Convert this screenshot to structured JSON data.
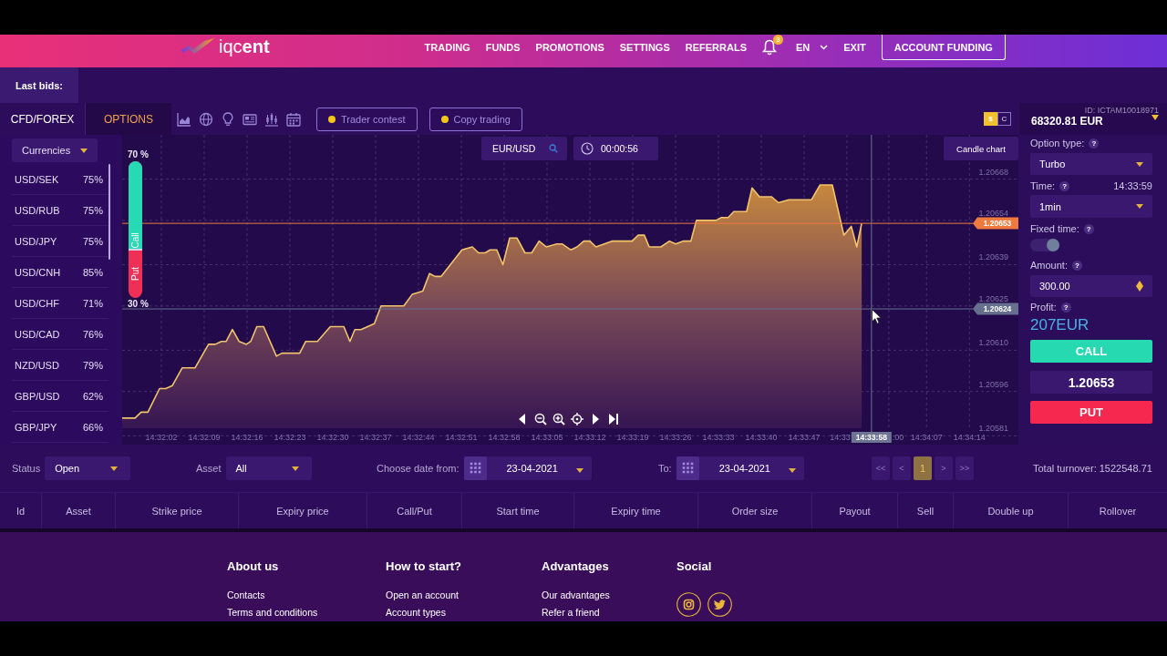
{
  "header": {
    "logo": "iqc**ent**",
    "nav": [
      "TRADING",
      "FUNDS",
      "PROMOTIONS",
      "SETTINGS",
      "REFERRALS"
    ],
    "notification_count": "3",
    "language": "EN",
    "exit": "EXIT",
    "funding_button": "ACCOUNT FUNDING"
  },
  "last_bids": "Last bids:",
  "toolbar": {
    "tabs": [
      {
        "label": "CFD/FOREX",
        "selected": false
      },
      {
        "label": "OPTIONS",
        "selected": true
      }
    ],
    "buttons": [
      "Trader contest",
      "Copy trading"
    ]
  },
  "account": {
    "currency_toggle": [
      {
        "label": "$",
        "selected": true
      },
      {
        "label": "C",
        "selected": false
      }
    ],
    "id": "ID: ICTAM10018971",
    "balance": "68320.81 EUR"
  },
  "sidebar": {
    "filter": "Currencies",
    "assets": [
      {
        "pair": "USD/SEK",
        "payout": "75%"
      },
      {
        "pair": "USD/RUB",
        "payout": "75%"
      },
      {
        "pair": "USD/JPY",
        "payout": "75%"
      },
      {
        "pair": "USD/CNH",
        "payout": "85%"
      },
      {
        "pair": "USD/CHF",
        "payout": "71%"
      },
      {
        "pair": "USD/CAD",
        "payout": "76%"
      },
      {
        "pair": "NZD/USD",
        "payout": "79%"
      },
      {
        "pair": "GBP/USD",
        "payout": "62%"
      },
      {
        "pair": "GBP/JPY",
        "payout": "66%"
      }
    ]
  },
  "chart": {
    "symbol": "EUR/USD",
    "timer": "00:00:56",
    "type_button": "Candle chart",
    "sentiment": {
      "call_percent": "70 %",
      "call_label": "Call",
      "put_label": "Put",
      "put_percent": "30 %",
      "level": 0.65
    },
    "cursor_time": "14:33:58",
    "cut_tick_labels": [
      "14:33",
      ":00"
    ],
    "chart_data": {
      "type": "area",
      "grid": true,
      "x": [
        52315.6,
        52317.7,
        52318.7,
        52319.8,
        52321.7,
        52322.7,
        52323.8,
        52325.4,
        52327.5,
        52329.7,
        52330.8,
        52331.8,
        52332.6,
        52333.6,
        52334.7,
        52335.9,
        52336.6,
        52337.6,
        52338.7,
        52340.8,
        52341.7,
        52344.6,
        52345.6,
        52347.5,
        52349.6,
        52351.8,
        52352.8,
        52353.6,
        52354.6,
        52356.8,
        52357.9,
        52361.6,
        52363,
        52364.7,
        52365.8,
        52366.7,
        52367.7,
        52371.1,
        52372.8,
        52373.8,
        52374.9,
        52375.7,
        52376.8,
        52377.8,
        52378.9,
        52380.1,
        52381.4,
        52382.5,
        52383.7,
        52384.9,
        52386.6,
        52387.5,
        52388.9,
        52389.9,
        52391,
        52392,
        52393,
        52395.7,
        52398.9,
        52399.9,
        52400.9,
        52401.7,
        52403.6,
        52405,
        52406,
        52407.3,
        52408.5,
        52409.4,
        52412.6,
        52413.5,
        52414.6,
        52415.5,
        52417.6,
        52418.5,
        52419.7,
        52421.7,
        52422.8,
        52424.5,
        52428.2,
        52429.6,
        52431.6,
        52433.5,
        52434.7,
        52435.6,
        52436.4
      ],
      "series": [
        {
          "color": "#f2c46a",
          "values": [
            1.20587,
            1.20587,
            1.20589,
            1.20589,
            1.20597,
            1.20597,
            1.20598,
            1.20604,
            1.20604,
            1.20612,
            1.20612,
            1.20613,
            1.20613,
            1.20617,
            1.20613,
            1.20612,
            1.20613,
            1.20618,
            1.20618,
            1.20608,
            1.20609,
            1.20609,
            1.20613,
            1.20613,
            1.20618,
            1.20618,
            1.20613,
            1.20617,
            1.20617,
            1.20619,
            1.20625,
            1.20625,
            1.20629,
            1.2063,
            1.20636,
            1.20635,
            1.20635,
            1.20644,
            1.20645,
            1.20643,
            1.20643,
            1.20644,
            1.20644,
            1.20639,
            1.20648,
            1.20648,
            1.20643,
            1.20643,
            1.20647,
            1.20645,
            1.20646,
            1.20646,
            1.20644,
            1.20645,
            1.20647,
            1.20647,
            1.20645,
            1.20647,
            1.20647,
            1.20649,
            1.20649,
            1.20645,
            1.20645,
            1.20647,
            1.20646,
            1.20647,
            1.20647,
            1.20654,
            1.20654,
            1.20655,
            1.20655,
            1.20657,
            1.20657,
            1.20665,
            1.20662,
            1.20662,
            1.2066,
            1.20661,
            1.20661,
            1.20666,
            1.20666,
            1.20649,
            1.20652,
            1.20645,
            1.20653
          ]
        }
      ],
      "xlim": [
        52315.6,
        52462
      ],
      "ylim": [
        1.20578,
        1.20683
      ],
      "xticks": [
        {
          "value": 52322,
          "label": "14:32:02"
        },
        {
          "value": 52329,
          "label": "14:32:09"
        },
        {
          "value": 52336,
          "label": "14:32:16"
        },
        {
          "value": 52343,
          "label": "14:32:23"
        },
        {
          "value": 52350,
          "label": "14:32:30"
        },
        {
          "value": 52357,
          "label": "14:32:37"
        },
        {
          "value": 52364,
          "label": "14:32:44"
        },
        {
          "value": 52371,
          "label": "14:32:51"
        },
        {
          "value": 52378,
          "label": "14:32:58"
        },
        {
          "value": 52385,
          "label": "14:33:05"
        },
        {
          "value": 52392,
          "label": "14:33:12"
        },
        {
          "value": 52399,
          "label": "14:33:19"
        },
        {
          "value": 52406,
          "label": "14:33:26"
        },
        {
          "value": 52413,
          "label": "14:33:33"
        },
        {
          "value": 52420,
          "label": "14:33:40"
        },
        {
          "value": 52427,
          "label": "14:33:47"
        },
        {
          "value": 52447,
          "label": "14:34:07"
        },
        {
          "value": 52454,
          "label": "14:34:14"
        }
      ],
      "yticks": [
        1.20668,
        1.20654,
        1.20639,
        1.20625,
        {
          "value": 1.2061,
          "label": "1.20610"
        },
        1.20596,
        1.20581
      ],
      "ref_lines": [
        {
          "axis": "y",
          "value": 1.20653,
          "label": "1.20653",
          "color": "#ef7a3f"
        },
        {
          "axis": "y",
          "value": 1.20624,
          "label": "1.20624",
          "color": "#66708e"
        },
        {
          "axis": "x",
          "value": 52438,
          "color": "#6e7494"
        }
      ]
    }
  },
  "trade": {
    "option_type": {
      "label": "Option type:",
      "help": "?",
      "value": "Turbo"
    },
    "time": {
      "label": "Time:",
      "help": "?",
      "clock": "14:33:59",
      "value": "1min"
    },
    "fixed_time": {
      "label": "Fixed time:",
      "help": "?",
      "on": true
    },
    "amount": {
      "label": "Amount:",
      "help": "?",
      "value": "300.00"
    },
    "profit": {
      "label": "Profit:",
      "help": "?",
      "value": "207EUR"
    },
    "call_button": "CALL",
    "price": "1.20653",
    "put_button": "PUT"
  },
  "filters": {
    "status": {
      "label": "Status",
      "value": "Open"
    },
    "asset": {
      "label": "Asset",
      "value": "All"
    },
    "date_from": {
      "label": "Choose date from:",
      "value": "23-04-2021"
    },
    "date_to": {
      "label": "To:",
      "value": "23-04-2021"
    },
    "pagination": [
      {
        "label": "<<",
        "selected": false
      },
      {
        "label": "<",
        "selected": false
      },
      {
        "label": "1",
        "selected": true
      },
      {
        "label": ">",
        "selected": false
      },
      {
        "label": ">>",
        "selected": false
      }
    ],
    "total_turnover": "Total turnover: 1522548.71"
  },
  "table": {
    "columns": [
      "Id",
      "Asset",
      "Strike price",
      "Expiry price",
      "Call/Put",
      "Start time",
      "Expiry time",
      "Order size",
      "Payout",
      "Sell",
      "Double up",
      "Rollover"
    ]
  },
  "footer": {
    "columns": [
      {
        "kind": "links",
        "heading": "About us",
        "links": [
          "Contacts",
          "Terms and conditions"
        ]
      },
      {
        "kind": "links",
        "heading": "How to start?",
        "links": [
          "Open an account",
          "Account types"
        ]
      },
      {
        "kind": "links",
        "heading": "Advantages",
        "links": [
          "Our advantages",
          "Refer a friend"
        ]
      },
      {
        "kind": "social",
        "heading": "Social"
      }
    ]
  }
}
